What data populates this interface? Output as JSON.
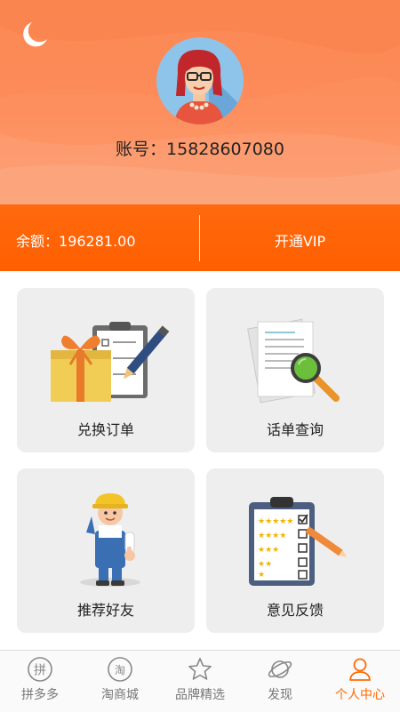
{
  "header": {
    "account_label": "账号：",
    "account_value": "15828607080"
  },
  "balance_bar": {
    "balance_label": "余额：",
    "balance_value": "196281.00",
    "vip_label": "开通VIP"
  },
  "cards": [
    {
      "label": "兑换订单",
      "icon": "gift-order-icon"
    },
    {
      "label": "话单查询",
      "icon": "document-search-icon"
    },
    {
      "label": "推荐好友",
      "icon": "worker-recommend-icon"
    },
    {
      "label": "意见反馈",
      "icon": "feedback-clipboard-icon"
    }
  ],
  "tabbar": {
    "items": [
      {
        "label": "拼多多",
        "icon_text": "拼",
        "active": false
      },
      {
        "label": "淘商城",
        "icon_text": "淘",
        "active": false
      },
      {
        "label": "品牌精选",
        "icon": "star-icon",
        "active": false
      },
      {
        "label": "发现",
        "icon": "planet-icon",
        "active": false
      },
      {
        "label": "个人中心",
        "icon": "person-icon",
        "active": true
      }
    ]
  },
  "colors": {
    "accent": "#ff6a00",
    "header": "#fd8f5e",
    "bar": "#ff6308",
    "card": "#eeeeee"
  }
}
